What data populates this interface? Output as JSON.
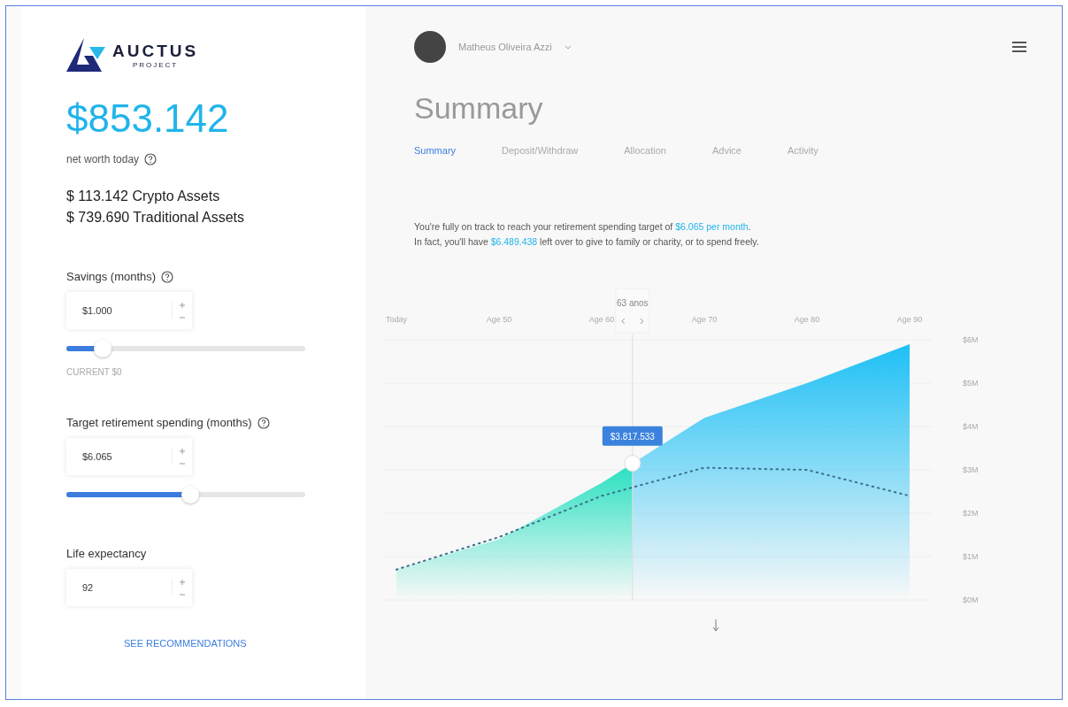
{
  "logo": {
    "name": "AUCTUS",
    "tagline": "PROJECT"
  },
  "net_worth": {
    "amount": "$853.142",
    "label": "net worth today"
  },
  "assets": [
    "$ 113.142 Crypto Assets",
    "$ 739.690 Traditional Assets"
  ],
  "inputs": [
    {
      "kind": "slider",
      "label": "Savings (months)",
      "help": true,
      "value": "$1.000",
      "level": 0.15,
      "note": "CURRENT $0"
    },
    {
      "kind": "slider",
      "label": "Target retirement spending (months)",
      "help": true,
      "value": "$6.065",
      "level": 0.52
    },
    {
      "kind": "plain",
      "label": "Life expectancy",
      "help": false,
      "value": "92"
    }
  ],
  "recommendations_link": "SEE RECOMMENDATIONS",
  "user": {
    "name": "Matheus Oliveira Azzi"
  },
  "title": "Summary",
  "tabs": [
    {
      "label": "Summary",
      "selected": true
    },
    {
      "label": "Deposit/Withdraw",
      "selected": false
    },
    {
      "label": "Allocation",
      "selected": false
    },
    {
      "label": "Advice",
      "selected": false
    },
    {
      "label": "Activity",
      "selected": false
    }
  ],
  "message": [
    [
      {
        "text": "You're fully on track to reach your retirement spending target of ",
        "highlight": false
      },
      {
        "text": "$6.065 per month",
        "highlight": true
      },
      {
        "text": ".",
        "highlight": false
      }
    ],
    [
      {
        "text": "In fact, you'll have ",
        "highlight": false
      },
      {
        "text": "$6.489.438",
        "highlight": true
      },
      {
        "text": " left over to give to family or charity, or to spend freely.",
        "highlight": false
      }
    ]
  ],
  "chart": {
    "marker": {
      "label": "63 anos",
      "value": "$3.817.533",
      "level": 0.46
    },
    "chart_data": {
      "type": "area",
      "categories": [
        "Today",
        "Age 50",
        "Age 60",
        "Age 70",
        "Age 80",
        "Age 90"
      ],
      "series": [
        {
          "color": "#1ec0f5",
          "values": [
            0.7,
            1.4,
            2.7,
            4.2,
            5.0,
            5.9
          ]
        },
        {
          "type": "line",
          "line_style": "dotted",
          "color": "#3a6f8a",
          "values": [
            0.7,
            1.45,
            2.4,
            3.05,
            3.0,
            2.4
          ]
        }
      ],
      "ylim": [
        0,
        6
      ],
      "yticks": [
        {
          "value": 0,
          "label": "$0M"
        },
        {
          "value": 1,
          "label": "$1M"
        },
        {
          "value": 2,
          "label": "$2M"
        },
        {
          "value": 3,
          "label": "$3M"
        },
        {
          "value": 4,
          "label": "$4M"
        },
        {
          "value": 5,
          "label": "$5M"
        },
        {
          "value": 6,
          "label": "$6M"
        }
      ]
    }
  }
}
